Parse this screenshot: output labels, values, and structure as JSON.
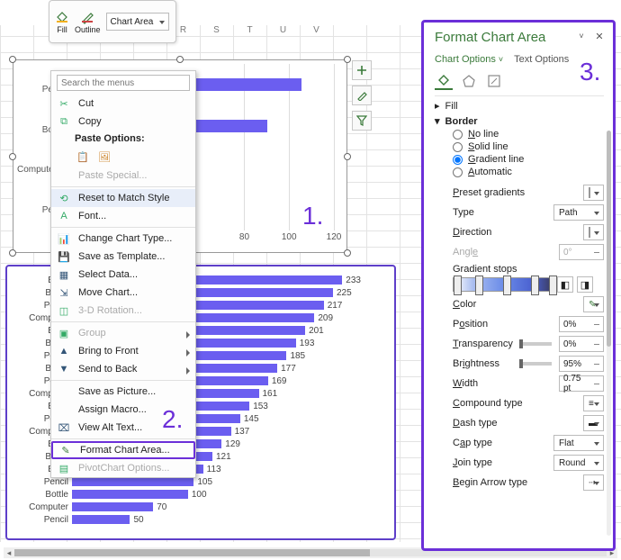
{
  "toolbar": {
    "fill_label": "Fill",
    "outline_label": "Outline",
    "scope_value": "Chart Area"
  },
  "columns": [
    "",
    "",
    "",
    "",
    "",
    "R",
    "S",
    "T",
    "U",
    "V"
  ],
  "annotations": {
    "one": "1.",
    "two": "2.",
    "three": "3."
  },
  "chart_data": [
    {
      "type": "bar",
      "orientation": "horizontal",
      "categories": [
        "Pe…",
        "Bo…",
        "Compute…",
        "Pe…"
      ],
      "values": [
        106,
        90,
        42,
        0
      ],
      "xlim": [
        0,
        120
      ],
      "x_ticks": [
        80,
        100,
        120
      ]
    },
    {
      "type": "bar",
      "orientation": "horizontal",
      "categories": [
        "Book",
        "Bottle",
        "Pencil",
        "Computer",
        "Book",
        "Bottle",
        "Pencil",
        "Bottle",
        "Pencil",
        "Computer",
        "Book",
        "Pencil",
        "Computer",
        "Book",
        "Bottle",
        "Book",
        "Pencil",
        "Bottle",
        "Computer",
        "Pencil"
      ],
      "values": [
        233,
        225,
        217,
        209,
        201,
        193,
        185,
        177,
        169,
        161,
        153,
        145,
        137,
        129,
        121,
        113,
        105,
        100,
        70,
        50
      ],
      "xlim": [
        0,
        270
      ]
    }
  ],
  "context_menu": {
    "search_placeholder": "Search the menus",
    "cut": "Cut",
    "copy": "Copy",
    "paste_options": "Paste Options:",
    "paste_special": "Paste Special...",
    "reset": "Reset to Match Style",
    "font": "Font...",
    "change_type": "Change Chart Type...",
    "save_template": "Save as Template...",
    "select_data": "Select Data...",
    "move_chart": "Move Chart...",
    "rotation": "3-D Rotation...",
    "group": "Group",
    "bring_front": "Bring to Front",
    "send_back": "Send to Back",
    "save_picture": "Save as Picture...",
    "assign_macro": "Assign Macro...",
    "alt_text": "View Alt Text...",
    "format_chart_area": "Format Chart Area...",
    "pivot_options": "PivotChart Options..."
  },
  "side_buttons": {
    "plus": "+",
    "brush": "brush",
    "filter": "filter"
  },
  "pane": {
    "title": "Format Chart Area",
    "chart_options": "Chart Options",
    "text_options": "Text Options",
    "fill_section": "Fill",
    "border_section": "Border",
    "no_line": "No line",
    "solid_line": "Solid line",
    "gradient_line": "Gradient line",
    "automatic": "Automatic",
    "preset_gradients": "Preset gradients",
    "type": "Type",
    "type_value": "Path",
    "direction": "Direction",
    "angle": "Angle",
    "angle_value": "0°",
    "gradient_stops": "Gradient stops",
    "color": "Color",
    "position": "Position",
    "position_value": "0%",
    "transparency": "Transparency",
    "transparency_value": "0%",
    "brightness": "Brightness",
    "brightness_value": "95%",
    "width": "Width",
    "width_value": "0.75 pt",
    "compound": "Compound type",
    "dash": "Dash type",
    "cap": "Cap type",
    "cap_value": "Flat",
    "join": "Join type",
    "join_value": "Round",
    "begin_arrow": "Begin Arrow type"
  }
}
